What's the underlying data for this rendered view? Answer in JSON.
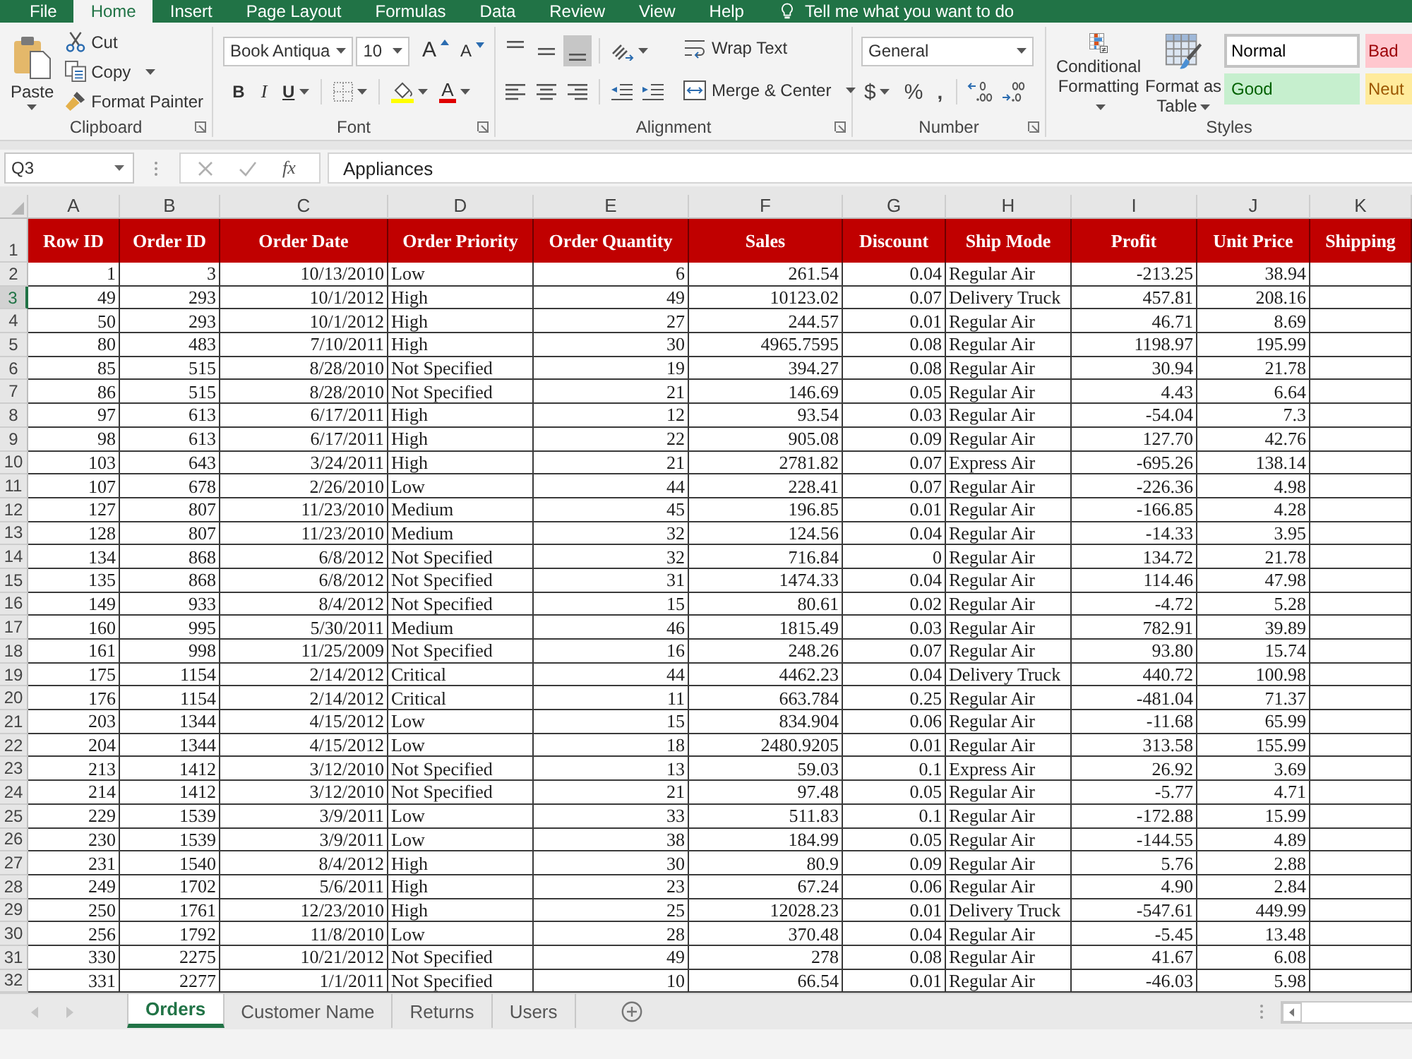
{
  "ribbon_tabs": [
    {
      "label": "File",
      "selected": false
    },
    {
      "label": "Home",
      "selected": true
    },
    {
      "label": "Insert",
      "selected": false
    },
    {
      "label": "Page Layout",
      "selected": false
    },
    {
      "label": "Formulas",
      "selected": false
    },
    {
      "label": "Data",
      "selected": false
    },
    {
      "label": "Review",
      "selected": false
    },
    {
      "label": "View",
      "selected": false
    },
    {
      "label": "Help",
      "selected": false
    }
  ],
  "tell_me": {
    "placeholder": "Tell me what you want to do"
  },
  "clipboard": {
    "paste": "Paste",
    "cut": "Cut",
    "copy": "Copy",
    "format_painter": "Format Painter",
    "label": "Clipboard"
  },
  "font": {
    "font_name": "Book Antiqua",
    "font_size": "10",
    "grow": "A",
    "shrink": "A",
    "bold": "B",
    "italic": "I",
    "underline": "U",
    "font_color": "A",
    "label": "Font"
  },
  "alignment": {
    "vertical": [
      {
        "kind": "top",
        "selected": false
      },
      {
        "kind": "middle",
        "selected": false
      },
      {
        "kind": "bottom",
        "selected": true
      }
    ],
    "horizontal": [
      {
        "kind": "left",
        "selected": false
      },
      {
        "kind": "center",
        "selected": false
      },
      {
        "kind": "right",
        "selected": false
      }
    ],
    "wrap_text": "Wrap Text",
    "merge_center": "Merge & Center",
    "label": "Alignment"
  },
  "number": {
    "format": "General",
    "currency": "$",
    "percent": "%",
    "comma": ",",
    "label": "Number"
  },
  "styles": {
    "conditional_formatting": "Conditional Formatting",
    "format_as_table": "Format as Table",
    "cell_styles": [
      {
        "label": "Normal",
        "kind": "normal",
        "selected": true
      },
      {
        "label": "Bad",
        "kind": "bad",
        "selected": false
      },
      {
        "label": "Good",
        "kind": "good",
        "selected": false
      },
      {
        "label": "Neut",
        "kind": "neutral",
        "selected": false
      }
    ],
    "label": "Styles"
  },
  "formula_bar": {
    "name_box": "Q3",
    "function_label": "fx",
    "value": "Appliances"
  },
  "sheet": {
    "columns": [
      {
        "letter": "A",
        "heading": "Row ID",
        "kind": "number"
      },
      {
        "letter": "B",
        "heading": "Order ID",
        "kind": "number"
      },
      {
        "letter": "C",
        "heading": "Order Date",
        "kind": "number"
      },
      {
        "letter": "D",
        "heading": "Order Priority",
        "kind": "text"
      },
      {
        "letter": "E",
        "heading": "Order Quantity",
        "kind": "number"
      },
      {
        "letter": "F",
        "heading": "Sales",
        "kind": "number"
      },
      {
        "letter": "G",
        "heading": "Discount",
        "kind": "number"
      },
      {
        "letter": "H",
        "heading": "Ship Mode",
        "kind": "text"
      },
      {
        "letter": "I",
        "heading": "Profit",
        "kind": "number"
      },
      {
        "letter": "J",
        "heading": "Unit Price",
        "kind": "number"
      },
      {
        "letter": "K",
        "heading": "Shipping",
        "kind": "number"
      }
    ],
    "header_row": "1",
    "rows": [
      {
        "number": "2",
        "selected": false,
        "cells": [
          "1",
          "3",
          "10/13/2010",
          "Low",
          "6",
          "261.54",
          "0.04",
          "Regular Air",
          "-213.25",
          "38.94"
        ]
      },
      {
        "number": "3",
        "selected": true,
        "cells": [
          "49",
          "293",
          "10/1/2012",
          "High",
          "49",
          "10123.02",
          "0.07",
          "Delivery Truck",
          "457.81",
          "208.16"
        ]
      },
      {
        "number": "4",
        "selected": false,
        "cells": [
          "50",
          "293",
          "10/1/2012",
          "High",
          "27",
          "244.57",
          "0.01",
          "Regular Air",
          "46.71",
          "8.69"
        ]
      },
      {
        "number": "5",
        "selected": false,
        "cells": [
          "80",
          "483",
          "7/10/2011",
          "High",
          "30",
          "4965.7595",
          "0.08",
          "Regular Air",
          "1198.97",
          "195.99"
        ]
      },
      {
        "number": "6",
        "selected": false,
        "cells": [
          "85",
          "515",
          "8/28/2010",
          "Not Specified",
          "19",
          "394.27",
          "0.08",
          "Regular Air",
          "30.94",
          "21.78"
        ]
      },
      {
        "number": "7",
        "selected": false,
        "cells": [
          "86",
          "515",
          "8/28/2010",
          "Not Specified",
          "21",
          "146.69",
          "0.05",
          "Regular Air",
          "4.43",
          "6.64"
        ]
      },
      {
        "number": "8",
        "selected": false,
        "cells": [
          "97",
          "613",
          "6/17/2011",
          "High",
          "12",
          "93.54",
          "0.03",
          "Regular Air",
          "-54.04",
          "7.3"
        ]
      },
      {
        "number": "9",
        "selected": false,
        "cells": [
          "98",
          "613",
          "6/17/2011",
          "High",
          "22",
          "905.08",
          "0.09",
          "Regular Air",
          "127.70",
          "42.76"
        ]
      },
      {
        "number": "10",
        "selected": false,
        "cells": [
          "103",
          "643",
          "3/24/2011",
          "High",
          "21",
          "2781.82",
          "0.07",
          "Express Air",
          "-695.26",
          "138.14"
        ]
      },
      {
        "number": "11",
        "selected": false,
        "cells": [
          "107",
          "678",
          "2/26/2010",
          "Low",
          "44",
          "228.41",
          "0.07",
          "Regular Air",
          "-226.36",
          "4.98"
        ]
      },
      {
        "number": "12",
        "selected": false,
        "cells": [
          "127",
          "807",
          "11/23/2010",
          "Medium",
          "45",
          "196.85",
          "0.01",
          "Regular Air",
          "-166.85",
          "4.28"
        ]
      },
      {
        "number": "13",
        "selected": false,
        "cells": [
          "128",
          "807",
          "11/23/2010",
          "Medium",
          "32",
          "124.56",
          "0.04",
          "Regular Air",
          "-14.33",
          "3.95"
        ]
      },
      {
        "number": "14",
        "selected": false,
        "cells": [
          "134",
          "868",
          "6/8/2012",
          "Not Specified",
          "32",
          "716.84",
          "0",
          "Regular Air",
          "134.72",
          "21.78"
        ]
      },
      {
        "number": "15",
        "selected": false,
        "cells": [
          "135",
          "868",
          "6/8/2012",
          "Not Specified",
          "31",
          "1474.33",
          "0.04",
          "Regular Air",
          "114.46",
          "47.98"
        ]
      },
      {
        "number": "16",
        "selected": false,
        "cells": [
          "149",
          "933",
          "8/4/2012",
          "Not Specified",
          "15",
          "80.61",
          "0.02",
          "Regular Air",
          "-4.72",
          "5.28"
        ]
      },
      {
        "number": "17",
        "selected": false,
        "cells": [
          "160",
          "995",
          "5/30/2011",
          "Medium",
          "46",
          "1815.49",
          "0.03",
          "Regular Air",
          "782.91",
          "39.89"
        ]
      },
      {
        "number": "18",
        "selected": false,
        "cells": [
          "161",
          "998",
          "11/25/2009",
          "Not Specified",
          "16",
          "248.26",
          "0.07",
          "Regular Air",
          "93.80",
          "15.74"
        ]
      },
      {
        "number": "19",
        "selected": false,
        "cells": [
          "175",
          "1154",
          "2/14/2012",
          "Critical",
          "44",
          "4462.23",
          "0.04",
          "Delivery Truck",
          "440.72",
          "100.98"
        ]
      },
      {
        "number": "20",
        "selected": false,
        "cells": [
          "176",
          "1154",
          "2/14/2012",
          "Critical",
          "11",
          "663.784",
          "0.25",
          "Regular Air",
          "-481.04",
          "71.37"
        ]
      },
      {
        "number": "21",
        "selected": false,
        "cells": [
          "203",
          "1344",
          "4/15/2012",
          "Low",
          "15",
          "834.904",
          "0.06",
          "Regular Air",
          "-11.68",
          "65.99"
        ]
      },
      {
        "number": "22",
        "selected": false,
        "cells": [
          "204",
          "1344",
          "4/15/2012",
          "Low",
          "18",
          "2480.9205",
          "0.01",
          "Regular Air",
          "313.58",
          "155.99"
        ]
      },
      {
        "number": "23",
        "selected": false,
        "cells": [
          "213",
          "1412",
          "3/12/2010",
          "Not Specified",
          "13",
          "59.03",
          "0.1",
          "Express Air",
          "26.92",
          "3.69"
        ]
      },
      {
        "number": "24",
        "selected": false,
        "cells": [
          "214",
          "1412",
          "3/12/2010",
          "Not Specified",
          "21",
          "97.48",
          "0.05",
          "Regular Air",
          "-5.77",
          "4.71"
        ]
      },
      {
        "number": "25",
        "selected": false,
        "cells": [
          "229",
          "1539",
          "3/9/2011",
          "Low",
          "33",
          "511.83",
          "0.1",
          "Regular Air",
          "-172.88",
          "15.99"
        ]
      },
      {
        "number": "26",
        "selected": false,
        "cells": [
          "230",
          "1539",
          "3/9/2011",
          "Low",
          "38",
          "184.99",
          "0.05",
          "Regular Air",
          "-144.55",
          "4.89"
        ]
      },
      {
        "number": "27",
        "selected": false,
        "cells": [
          "231",
          "1540",
          "8/4/2012",
          "High",
          "30",
          "80.9",
          "0.09",
          "Regular Air",
          "5.76",
          "2.88"
        ]
      },
      {
        "number": "28",
        "selected": false,
        "cells": [
          "249",
          "1702",
          "5/6/2011",
          "High",
          "23",
          "67.24",
          "0.06",
          "Regular Air",
          "4.90",
          "2.84"
        ]
      },
      {
        "number": "29",
        "selected": false,
        "cells": [
          "250",
          "1761",
          "12/23/2010",
          "High",
          "25",
          "12028.23",
          "0.01",
          "Delivery Truck",
          "-547.61",
          "449.99"
        ]
      },
      {
        "number": "30",
        "selected": false,
        "cells": [
          "256",
          "1792",
          "11/8/2010",
          "Low",
          "28",
          "370.48",
          "0.04",
          "Regular Air",
          "-5.45",
          "13.48"
        ]
      },
      {
        "number": "31",
        "selected": false,
        "cells": [
          "330",
          "2275",
          "10/21/2012",
          "Not Specified",
          "49",
          "278",
          "0.08",
          "Regular Air",
          "41.67",
          "6.08"
        ]
      },
      {
        "number": "32",
        "selected": false,
        "cells": [
          "331",
          "2277",
          "1/1/2011",
          "Not Specified",
          "10",
          "66.54",
          "0.01",
          "Regular Air",
          "-46.03",
          "5.98"
        ]
      }
    ]
  },
  "sheet_tabs": [
    {
      "label": "Orders",
      "selected": true
    },
    {
      "label": "Customer Name",
      "selected": false
    },
    {
      "label": "Returns",
      "selected": false
    },
    {
      "label": "Users",
      "selected": false
    }
  ]
}
